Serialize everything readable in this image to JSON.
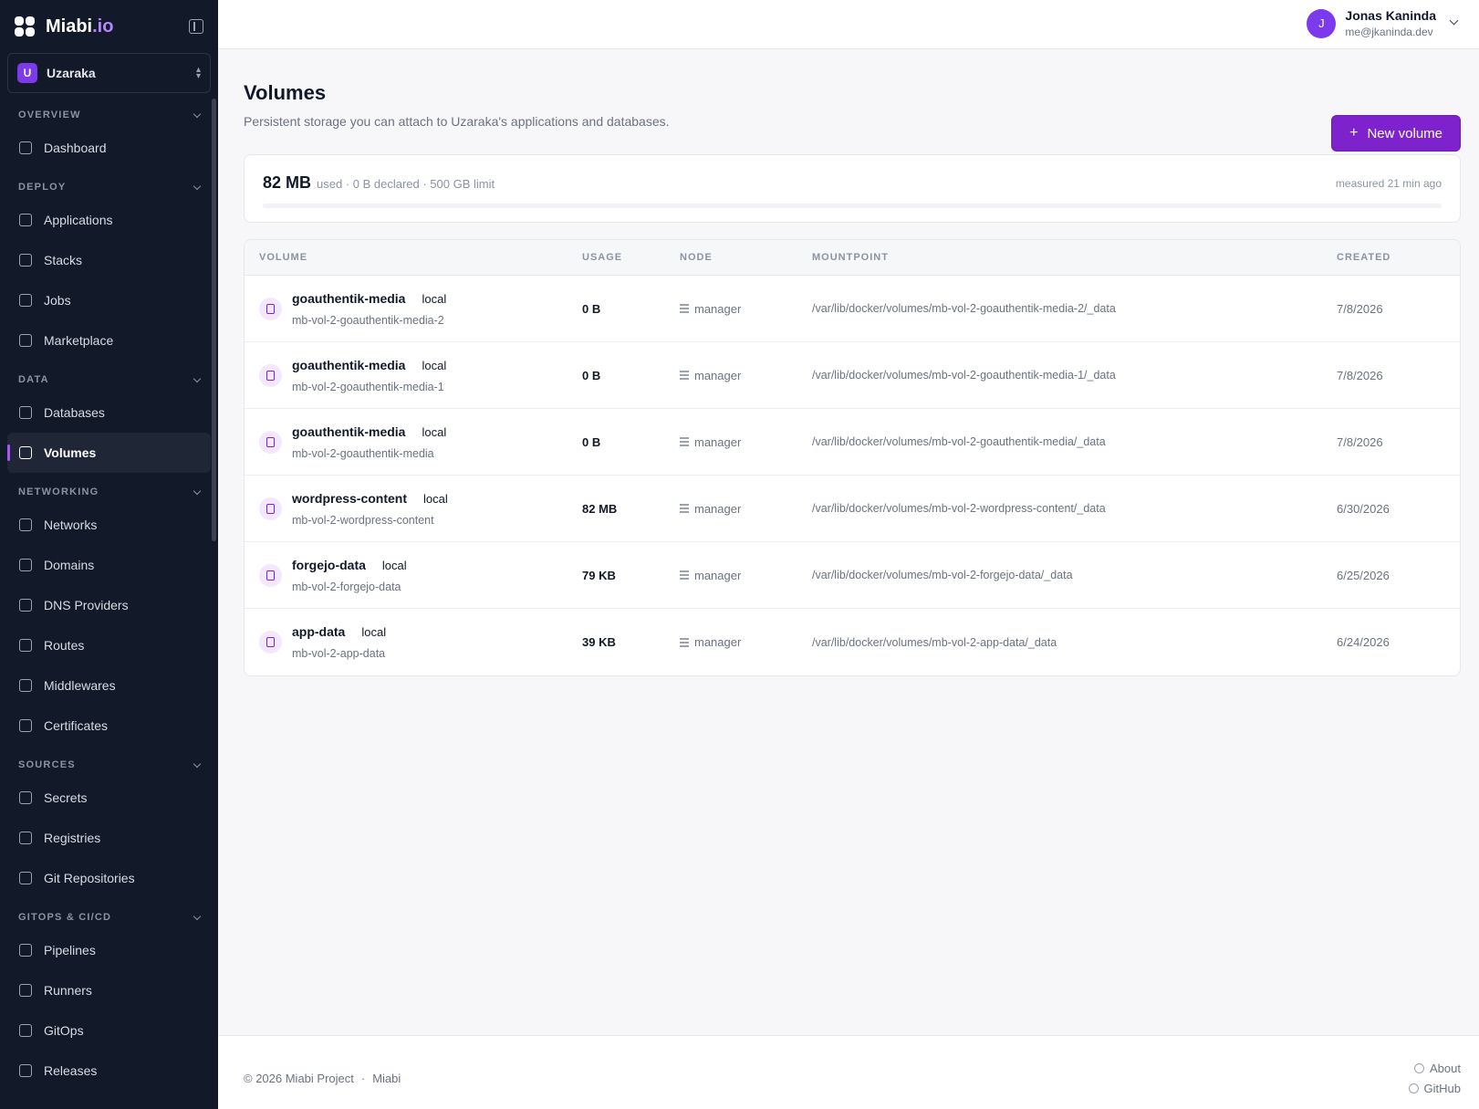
{
  "brand": {
    "name": "Miabi",
    "suffix": ".io"
  },
  "org": {
    "initial": "U",
    "name": "Uzaraka"
  },
  "sidebar": {
    "sections": [
      {
        "title": "OVERVIEW",
        "items": [
          {
            "label": "Dashboard",
            "icon": "dashboard-icon"
          }
        ]
      },
      {
        "title": "DEPLOY",
        "items": [
          {
            "label": "Applications",
            "icon": "cube-icon"
          },
          {
            "label": "Stacks",
            "icon": "layers-icon"
          },
          {
            "label": "Jobs",
            "icon": "terminal-icon"
          },
          {
            "label": "Marketplace",
            "icon": "store-icon"
          }
        ]
      },
      {
        "title": "DATA",
        "items": [
          {
            "label": "Databases",
            "icon": "database-icon"
          },
          {
            "label": "Volumes",
            "icon": "volume-icon",
            "active": true
          }
        ]
      },
      {
        "title": "NETWORKING",
        "items": [
          {
            "label": "Networks",
            "icon": "network-icon"
          },
          {
            "label": "Domains",
            "icon": "globe-icon"
          },
          {
            "label": "DNS Providers",
            "icon": "server-icon"
          },
          {
            "label": "Routes",
            "icon": "signpost-icon"
          },
          {
            "label": "Middlewares",
            "icon": "sliders-icon"
          },
          {
            "label": "Certificates",
            "icon": "certificate-icon"
          }
        ]
      },
      {
        "title": "SOURCES",
        "items": [
          {
            "label": "Secrets",
            "icon": "key-icon"
          },
          {
            "label": "Registries",
            "icon": "registry-icon"
          },
          {
            "label": "Git Repositories",
            "icon": "git-icon"
          }
        ]
      },
      {
        "title": "GITOPS & CI/CD",
        "items": [
          {
            "label": "Pipelines",
            "icon": "pipeline-icon"
          },
          {
            "label": "Runners",
            "icon": "gear-icon"
          },
          {
            "label": "GitOps",
            "icon": "git-branch-icon"
          },
          {
            "label": "Releases",
            "icon": "tag-icon"
          }
        ]
      }
    ]
  },
  "user": {
    "initial": "J",
    "name": "Jonas Kaninda",
    "email": "me@jkaninda.dev"
  },
  "page": {
    "title": "Volumes",
    "subtitle": "Persistent storage you can attach to Uzaraka's applications and databases.",
    "new_button": "New volume"
  },
  "usage": {
    "used": "82 MB",
    "meta": "used · 0 B declared · 500 GB limit",
    "measured": "measured 21 min ago",
    "fraction": 0.0
  },
  "table": {
    "headers": {
      "volume": "VOLUME",
      "usage": "USAGE",
      "node": "NODE",
      "mountpoint": "MOUNTPOINT",
      "created": "CREATED"
    },
    "rows": [
      {
        "name": "goauthentik-media",
        "driver": "local",
        "full": "mb-vol-2-goauthentik-media-2",
        "usage": "0 B",
        "node": "manager",
        "mount": "/var/lib/docker/volumes/mb-vol-2-goauthentik-media-2/_data",
        "created": "7/8/2026"
      },
      {
        "name": "goauthentik-media",
        "driver": "local",
        "full": "mb-vol-2-goauthentik-media-1",
        "usage": "0 B",
        "node": "manager",
        "mount": "/var/lib/docker/volumes/mb-vol-2-goauthentik-media-1/_data",
        "created": "7/8/2026"
      },
      {
        "name": "goauthentik-media",
        "driver": "local",
        "full": "mb-vol-2-goauthentik-media",
        "usage": "0 B",
        "node": "manager",
        "mount": "/var/lib/docker/volumes/mb-vol-2-goauthentik-media/_data",
        "created": "7/8/2026"
      },
      {
        "name": "wordpress-content",
        "driver": "local",
        "full": "mb-vol-2-wordpress-content",
        "usage": "82 MB",
        "node": "manager",
        "mount": "/var/lib/docker/volumes/mb-vol-2-wordpress-content/_data",
        "created": "6/30/2026"
      },
      {
        "name": "forgejo-data",
        "driver": "local",
        "full": "mb-vol-2-forgejo-data",
        "usage": "79 KB",
        "node": "manager",
        "mount": "/var/lib/docker/volumes/mb-vol-2-forgejo-data/_data",
        "created": "6/25/2026"
      },
      {
        "name": "app-data",
        "driver": "local",
        "full": "mb-vol-2-app-data",
        "usage": "39 KB",
        "node": "manager",
        "mount": "/var/lib/docker/volumes/mb-vol-2-app-data/_data",
        "created": "6/24/2026"
      }
    ]
  },
  "footer": {
    "copyright": "© 2026 Miabi Project",
    "dot": "·",
    "brand": "Miabi",
    "about": "About",
    "github": "GitHub"
  },
  "colors": {
    "accent": "#7e22ce",
    "sidebar_bg": "#121a2a"
  }
}
